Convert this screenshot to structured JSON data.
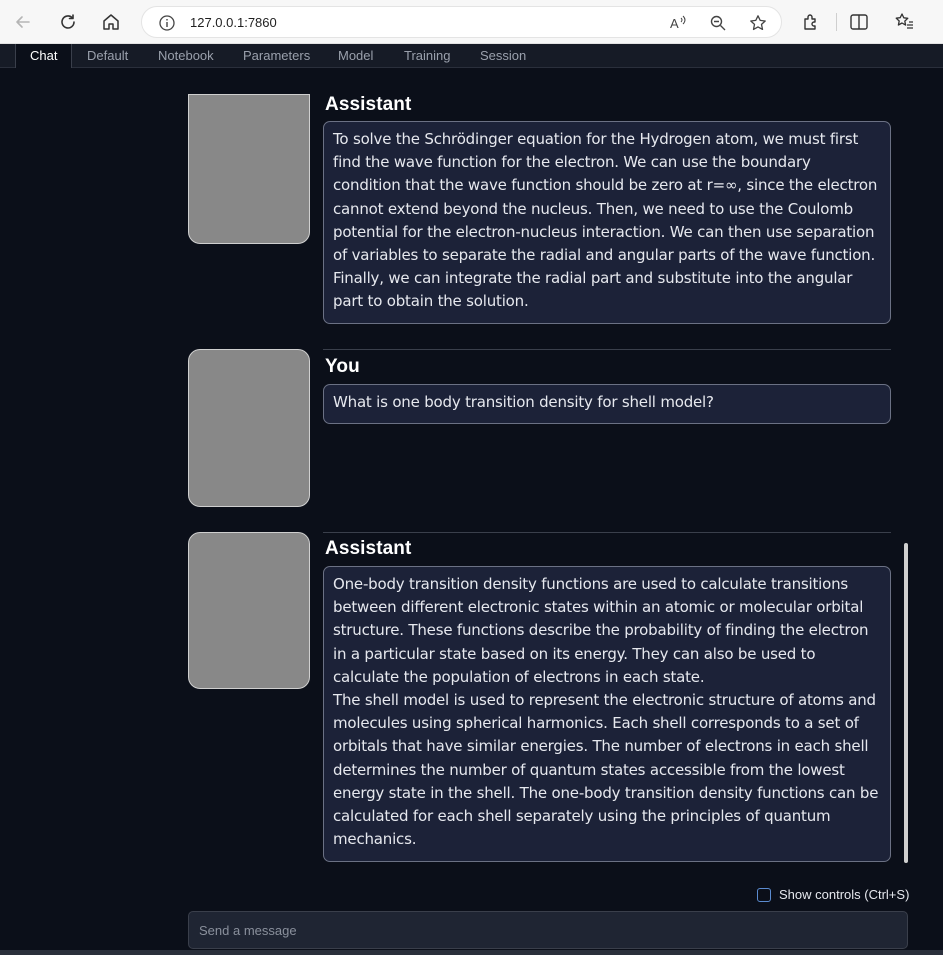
{
  "browser": {
    "url": "127.0.0.1:7860"
  },
  "tabs": [
    {
      "label": "Chat"
    },
    {
      "label": "Default"
    },
    {
      "label": "Notebook"
    },
    {
      "label": "Parameters"
    },
    {
      "label": "Model"
    },
    {
      "label": "Training"
    },
    {
      "label": "Session"
    }
  ],
  "messages": [
    {
      "speaker": "Assistant",
      "paragraphs": [
        "To solve the Schrödinger equation for the Hydrogen atom, we must first find the wave function for the electron. We can use the boundary condition that the wave function should be zero at r=∞, since the electron cannot extend beyond the nucleus. Then, we need to use the Coulomb potential for the electron-nucleus interaction. We can then use separation of variables to separate the radial and angular parts of the wave function. Finally, we can integrate the radial part and substitute into the angular part to obtain the solution."
      ]
    },
    {
      "speaker": "You",
      "paragraphs": [
        "What is one body transition density for shell model?"
      ]
    },
    {
      "speaker": "Assistant",
      "paragraphs": [
        "One-body transition density functions are used to calculate transitions between different electronic states within an atomic or molecular orbital structure. These functions describe the probability of finding the electron in a particular state based on its energy. They can also be used to calculate the population of electrons in each state.",
        "The shell model is used to represent the electronic structure of atoms and molecules using spherical harmonics. Each shell corresponds to a set of orbitals that have similar energies. The number of electrons in each shell determines the number of quantum states accessible from the lowest energy state in the shell. The one-body transition density functions can be calculated for each shell separately using the principles of quantum mechanics."
      ]
    }
  ],
  "controls": {
    "show_controls_label": "Show controls (Ctrl+S)",
    "message_placeholder": "Send a message"
  }
}
